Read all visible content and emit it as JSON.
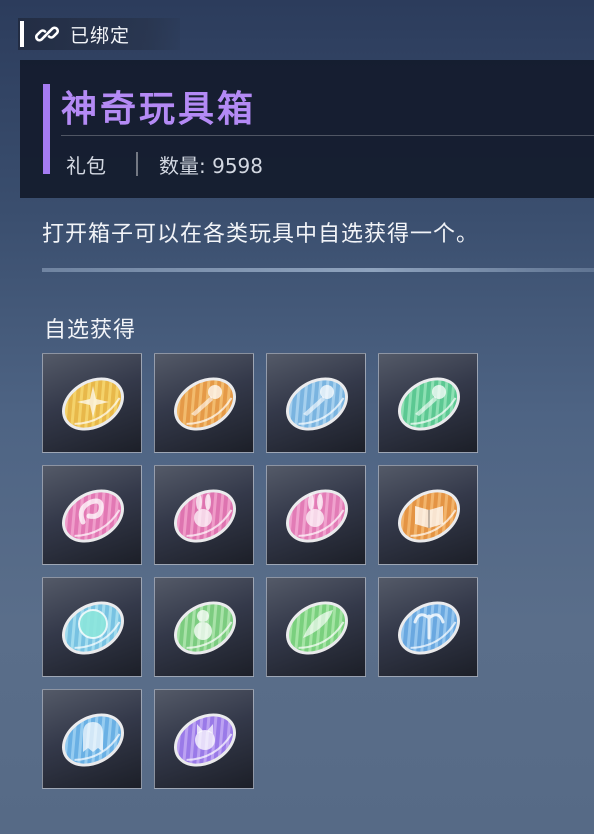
{
  "bind_tag": {
    "label": "已绑定"
  },
  "item": {
    "name": "神奇玩具箱",
    "type": "礼包",
    "count_label": "数量: 9598",
    "description": "打开箱子可以在各类玩具中自选获得一个。"
  },
  "selection": {
    "title": "自选获得",
    "rewards": [
      {
        "icon": "starburst-toy-token-icon",
        "color": "#e8b84a",
        "stripe": "#f4d26a"
      },
      {
        "icon": "comet-toy-token-icon",
        "color": "#e59a48",
        "stripe": "#f2bb6e"
      },
      {
        "icon": "comet-toy-token-icon",
        "color": "#7ab4e0",
        "stripe": "#a6d0ee"
      },
      {
        "icon": "comet-toy-token-icon",
        "color": "#5cc892",
        "stripe": "#8ee0b4"
      },
      {
        "icon": "swirl-toy-token-icon",
        "color": "#e278b4",
        "stripe": "#f09ecb"
      },
      {
        "icon": "bunny-toy-token-icon",
        "color": "#de74b0",
        "stripe": "#ef9cc8"
      },
      {
        "icon": "bunny-toy-token-icon",
        "color": "#e27cb6",
        "stripe": "#f0a2ce"
      },
      {
        "icon": "book-toy-token-icon",
        "color": "#e49444",
        "stripe": "#f2b46c"
      },
      {
        "icon": "orb-toy-token-icon",
        "color": "#78c2e2",
        "stripe": "#a2dcee"
      },
      {
        "icon": "snowman-toy-token-icon",
        "color": "#7ccc80",
        "stripe": "#a8e2a8"
      },
      {
        "icon": "feather-toy-token-icon",
        "color": "#7ad07e",
        "stripe": "#a4e4a4"
      },
      {
        "icon": "fountain-toy-token-icon",
        "color": "#6aa8e0",
        "stripe": "#96c6ee"
      },
      {
        "icon": "ghost-toy-token-icon",
        "color": "#6ab0e4",
        "stripe": "#96ccf0"
      },
      {
        "icon": "cat-toy-token-icon",
        "color": "#9a7ae8",
        "stripe": "#bca2f2"
      }
    ]
  }
}
